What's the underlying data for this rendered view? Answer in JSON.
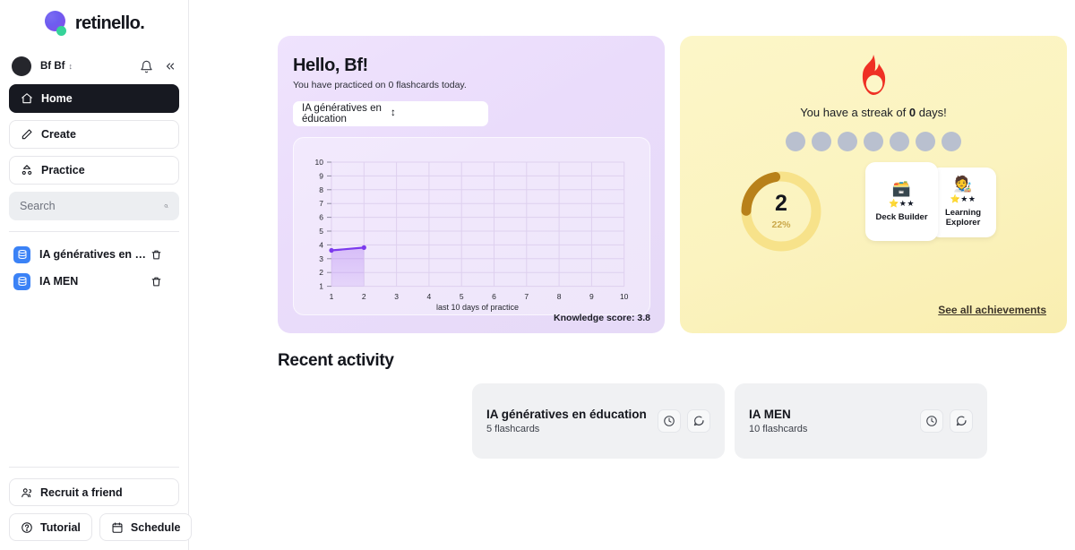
{
  "brand": {
    "name": "retinello.",
    "logo_icon": "retinello-logo-icon",
    "accent": "#6d5df0",
    "accent_dot": "#36d399"
  },
  "sidebar": {
    "user": {
      "name": "Bf Bf",
      "caret": "↕",
      "avatar_icon": "avatar-icon"
    },
    "header_icons": {
      "notifications": "bell-icon",
      "collapse": "«"
    },
    "nav": [
      {
        "label": "Home",
        "icon": "home-icon",
        "active": true
      },
      {
        "label": "Create",
        "icon": "pencil-icon",
        "active": false
      },
      {
        "label": "Practice",
        "icon": "practice-icon",
        "active": false
      }
    ],
    "search": {
      "placeholder": "Search",
      "value": "",
      "icon": "search-icon"
    },
    "decks": [
      {
        "label": "IA génératives en éd...",
        "icon": "deck-icon",
        "delete_icon": "trash-icon"
      },
      {
        "label": "IA MEN",
        "icon": "deck-icon",
        "delete_icon": "trash-icon"
      }
    ],
    "bottom": {
      "recruit": {
        "label": "Recruit a friend",
        "icon": "people-icon"
      },
      "tutorial": {
        "label": "Tutorial",
        "icon": "question-circle-icon"
      },
      "schedule": {
        "label": "Schedule",
        "icon": "calendar-icon"
      }
    }
  },
  "greeting": {
    "title": "Hello, Bf!",
    "subtitle": "You have practiced on 0 flashcards today.",
    "deck_select": {
      "value": "IA génératives en éducation",
      "caret": "↕"
    },
    "knowledge_score": "Knowledge score: 3.8",
    "card_color": "#eadcfb"
  },
  "chart_data": {
    "type": "line",
    "title": "",
    "xlabel": "last 10 days of practice",
    "ylabel": "",
    "x": [
      1,
      2,
      3,
      4,
      5,
      6,
      7,
      8,
      9,
      10
    ],
    "xticks": [
      "1",
      "2",
      "3",
      "4",
      "5",
      "6",
      "7",
      "8",
      "9",
      "10"
    ],
    "yticks": [
      "1",
      "2",
      "3",
      "4",
      "5",
      "6",
      "7",
      "8",
      "9",
      "10"
    ],
    "xlim": [
      1,
      10
    ],
    "ylim": [
      1,
      10
    ],
    "grid": true,
    "legend": "none",
    "series": [
      {
        "name": "Knowledge score",
        "color": "#7c3aed",
        "fill": true,
        "points": [
          {
            "x": 1,
            "y": 3.6
          },
          {
            "x": 2,
            "y": 3.8
          }
        ]
      }
    ]
  },
  "streak": {
    "flame_icon": "flame-icon",
    "flame_color": "#ef3024",
    "text_before": "You have a streak of ",
    "days": "0",
    "text_after": " days!",
    "dots": 7,
    "dot_color": "#b9c0cf",
    "card_color": "#fbf3bf"
  },
  "achievements": {
    "ring": {
      "count": "2",
      "percent": "22%",
      "track_color": "#f7e28a",
      "fill_color": "#b8811a"
    },
    "badges": [
      {
        "title": "Deck Builder",
        "emoji": "🗃️",
        "stars": "⭐★★"
      },
      {
        "title": "Learning Explorer",
        "emoji": "🧑‍🎨",
        "stars": "⭐★★"
      }
    ],
    "see_all": "See all achievements"
  },
  "recent": {
    "title": "Recent activity",
    "items": [
      {
        "name": "IA génératives en éducation",
        "count": "5 flashcards",
        "clock_icon": "clock-icon",
        "chat_icon": "chat-icon"
      },
      {
        "name": "IA MEN",
        "count": "10 flashcards",
        "clock_icon": "clock-icon",
        "chat_icon": "chat-icon"
      }
    ]
  }
}
